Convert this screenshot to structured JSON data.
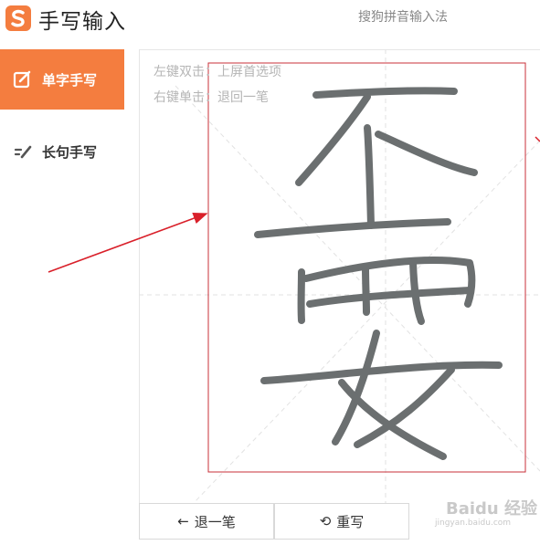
{
  "titlebar": {
    "title": "手写输入",
    "ime_name": "搜狗拼音输入法",
    "logo_icon": "sogou-logo-icon",
    "accent": "#f47d3f"
  },
  "sidebar": {
    "items": [
      {
        "label": "单字手写",
        "icon": "edit-square-icon",
        "active": true
      },
      {
        "label": "长句手写",
        "icon": "long-sentence-pen-icon",
        "active": false
      }
    ]
  },
  "canvas": {
    "hints": [
      "左键双击：上屏首选项",
      "右键单击：退回一笔"
    ],
    "handwritten_text": "不要"
  },
  "buttons": {
    "undo_label": "退一笔",
    "undo_icon": "arrow-left-icon",
    "rewrite_label": "重写",
    "rewrite_icon": "rotate-icon"
  },
  "watermark": {
    "text": "Baidu 经验",
    "url": "jingyan.baidu.com"
  },
  "annotation": {
    "color": "#d9202a"
  }
}
